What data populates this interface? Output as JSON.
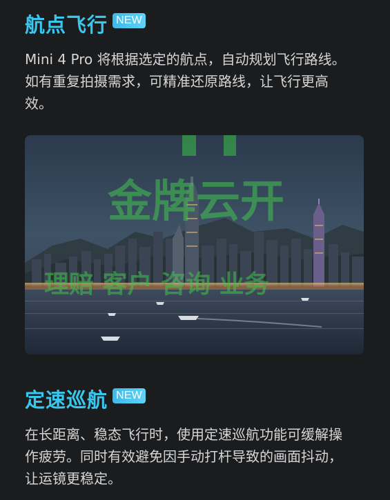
{
  "sections": [
    {
      "title": "航点飞行",
      "badge": "NEW",
      "description": "Mini 4 Pro 将根据选定的航点，自动规划飞行路线。如有重复拍摄需求，可精准还原路线，让飞行更高效。"
    },
    {
      "title": "定速巡航",
      "badge": "NEW",
      "description": "在长距离、稳态飞行时，使用定速巡航功能可缓解操作疲劳。同时有效避免因手动打杆导致的画面抖动，让运镜更稳定。"
    }
  ],
  "photo": {
    "subject": "Hong Kong Victoria Harbour skyline at dusk"
  },
  "watermark": {
    "line1": "金牌云开",
    "line2": "理赔 客户 咨询 业务"
  },
  "colors": {
    "background": "#1b1c1e",
    "heading": "#39c7ee",
    "badge": "#4cc3ef",
    "body_text": "#d6d6d6"
  }
}
